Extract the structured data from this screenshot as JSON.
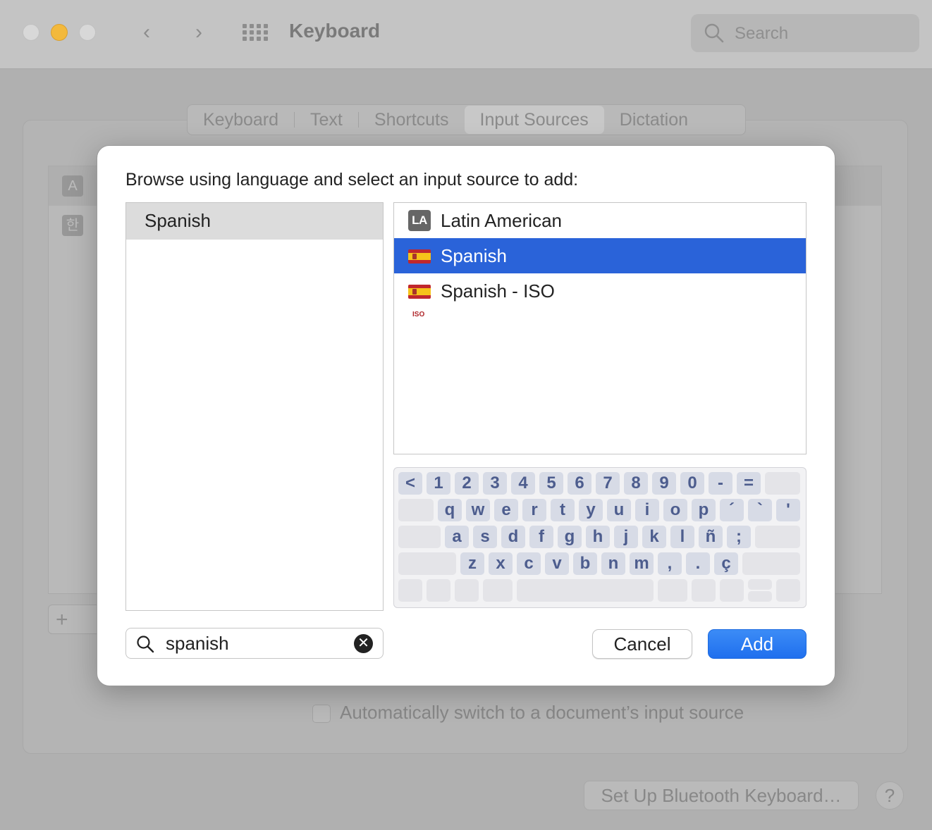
{
  "window": {
    "title": "Keyboard",
    "search_placeholder": "Search"
  },
  "tabs": [
    {
      "label": "Keyboard"
    },
    {
      "label": "Text"
    },
    {
      "label": "Shortcuts"
    },
    {
      "label": "Input Sources",
      "selected": true
    },
    {
      "label": "Dictation"
    }
  ],
  "background": {
    "input_icons": [
      "A",
      "한"
    ],
    "add_label": "+",
    "checkbox_label": "Automatically switch to a document’s input source",
    "bluetooth_button": "Set Up Bluetooth Keyboard…",
    "help_button": "?"
  },
  "sheet": {
    "prompt": "Browse using language and select an input source to add:",
    "languages": [
      {
        "label": "Spanish",
        "selected": true
      }
    ],
    "sources": [
      {
        "label": "Latin American",
        "icon": "la-badge-icon",
        "badge": "LA"
      },
      {
        "label": "Spanish",
        "icon": "spain-flag-icon",
        "selected": true
      },
      {
        "label": "Spanish - ISO",
        "icon": "spain-flag-iso-icon",
        "badge": "ISO"
      }
    ],
    "keyboard_rows": [
      [
        "<",
        "1",
        "2",
        "3",
        "4",
        "5",
        "6",
        "7",
        "8",
        "9",
        "0",
        "-",
        "="
      ],
      [
        "q",
        "w",
        "e",
        "r",
        "t",
        "y",
        "u",
        "i",
        "o",
        "p",
        "´",
        "`",
        "'"
      ],
      [
        "a",
        "s",
        "d",
        "f",
        "g",
        "h",
        "j",
        "k",
        "l",
        "ñ",
        ";"
      ],
      [
        "z",
        "x",
        "c",
        "v",
        "b",
        "n",
        "m",
        ",",
        ".",
        "ç"
      ]
    ],
    "search_value": "spanish",
    "cancel_label": "Cancel",
    "add_label": "Add"
  },
  "colors": {
    "selection": "#2a63d9",
    "add_button": "#2d7ff3",
    "key_text": "#4d5d8e",
    "minimize_light": "#f3b93c"
  }
}
